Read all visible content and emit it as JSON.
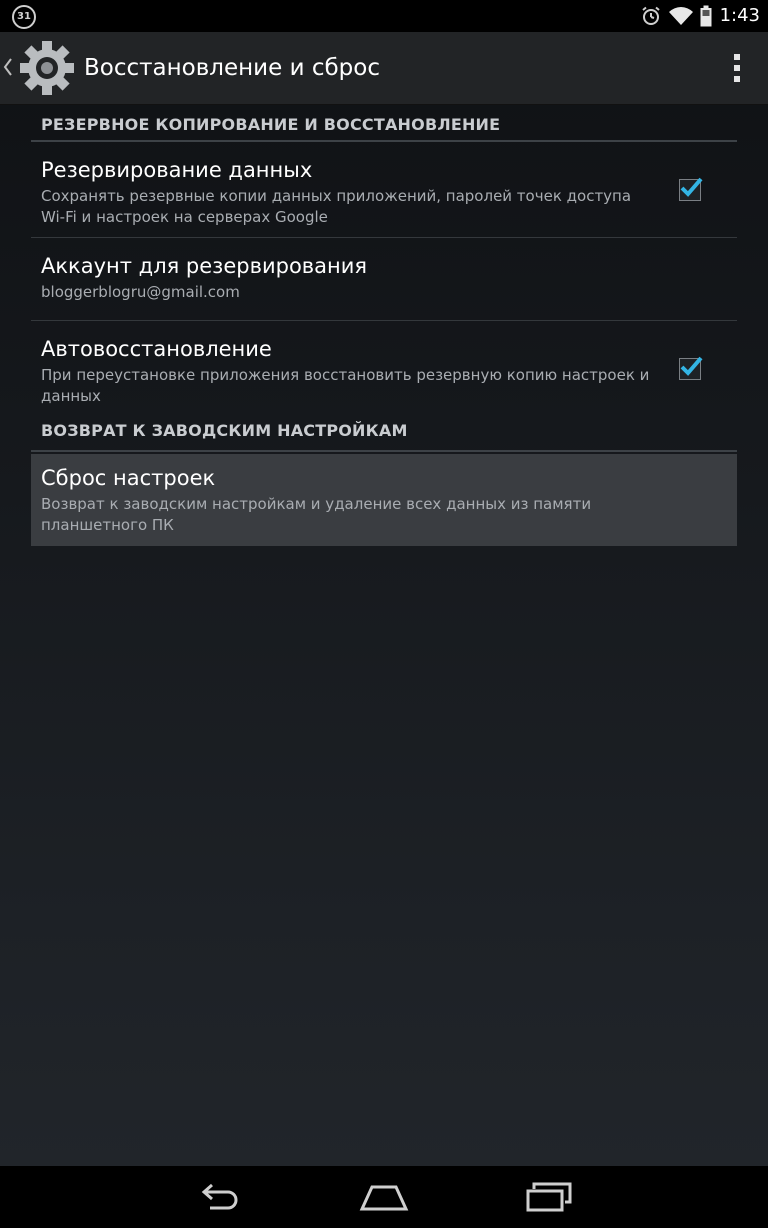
{
  "status_bar": {
    "notification_badge": "31",
    "time": "1:43",
    "icons": [
      "alarm-icon",
      "wifi-icon",
      "battery-icon"
    ]
  },
  "action_bar": {
    "title": "Восстановление и сброс",
    "app_icon": "settings-gear-icon",
    "up_icon": "chevron-left-icon",
    "overflow_icon": "overflow-menu-icon"
  },
  "sections": [
    {
      "header": "РЕЗЕРВНОЕ КОПИРОВАНИЕ И ВОССТАНОВЛЕНИЕ",
      "items": [
        {
          "title": "Резервирование данных",
          "summary": "Сохранять резервные копии данных приложений, паролей точек доступа Wi-Fi и настроек на серверах Google",
          "checked": true
        },
        {
          "title": "Аккаунт для резервирования",
          "summary": "bloggerblogru@gmail.com"
        },
        {
          "title": "Автовосстановление",
          "summary": "При переустановке приложения восстановить резервную копию настроек и данных",
          "checked": true
        }
      ]
    },
    {
      "header": "ВОЗВРАТ К ЗАВОДСКИМ НАСТРОЙКАМ",
      "items": [
        {
          "title": "Сброс настроек",
          "summary": "Возврат к заводским настройкам и удаление всех данных из памяти планшетного ПК",
          "pressed": true
        }
      ]
    }
  ],
  "nav_bar": {
    "buttons": [
      "back-icon",
      "home-icon",
      "recents-icon"
    ]
  },
  "colors": {
    "accent": "#33b5e5",
    "action_bar_bg": "#222426",
    "pressed_bg": "#3a3d41",
    "section_header_text": "#c9ccd0",
    "summary_text": "#a9adb2"
  }
}
